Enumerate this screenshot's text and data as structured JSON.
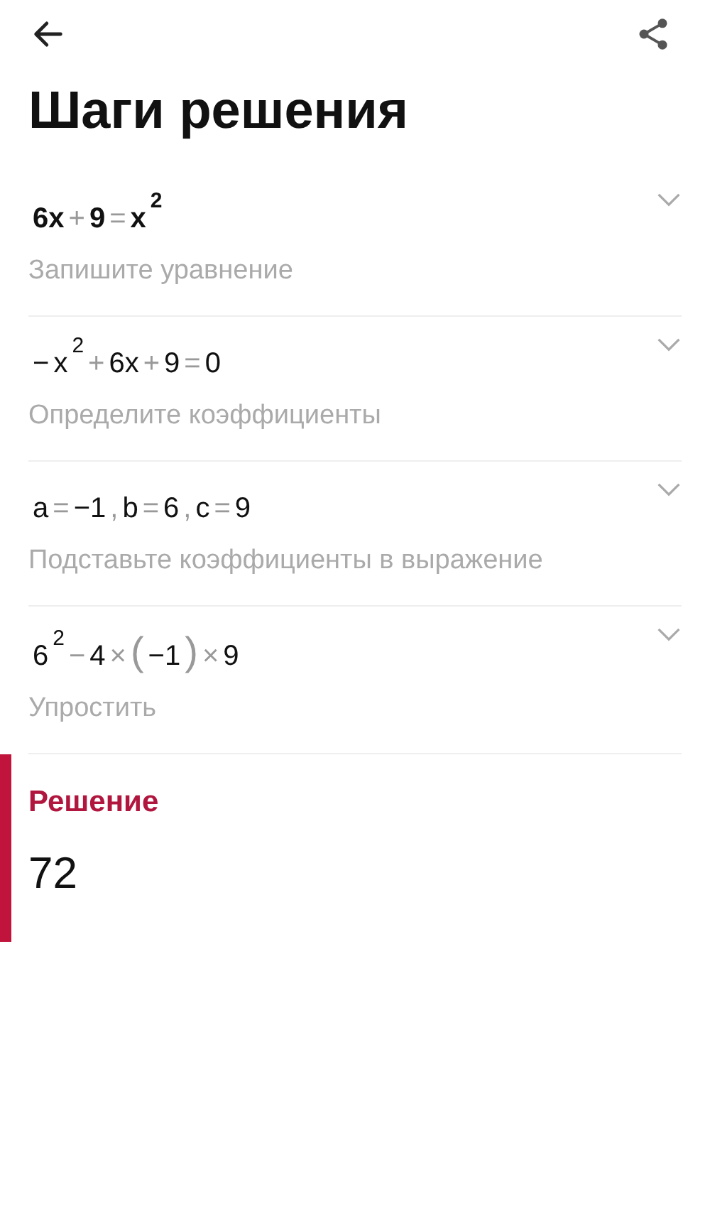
{
  "header": {
    "title": "Шаги решения"
  },
  "steps": [
    {
      "bold": true,
      "expanded": false,
      "description": "Запишите уравнение",
      "expression": [
        {
          "kind": "term",
          "text": "6x"
        },
        {
          "kind": "op",
          "text": "+"
        },
        {
          "kind": "term",
          "text": "9"
        },
        {
          "kind": "op",
          "text": "="
        },
        {
          "kind": "term",
          "text": "x"
        },
        {
          "kind": "sup",
          "text": "2"
        }
      ]
    },
    {
      "bold": false,
      "expanded": false,
      "description": "Определите коэффициенты",
      "expression": [
        {
          "kind": "term",
          "text": "−"
        },
        {
          "kind": "term",
          "text": "x"
        },
        {
          "kind": "sup",
          "text": "2"
        },
        {
          "kind": "op",
          "text": "+"
        },
        {
          "kind": "term",
          "text": "6x"
        },
        {
          "kind": "op",
          "text": "+"
        },
        {
          "kind": "term",
          "text": "9"
        },
        {
          "kind": "op",
          "text": "="
        },
        {
          "kind": "term",
          "text": "0"
        }
      ]
    },
    {
      "bold": false,
      "expanded": false,
      "description": "Подставьте коэффициенты в выражение",
      "expression": [
        {
          "kind": "term",
          "text": "a"
        },
        {
          "kind": "op",
          "text": "="
        },
        {
          "kind": "term",
          "text": "−1"
        },
        {
          "kind": "op",
          "text": ","
        },
        {
          "kind": "term",
          "text": "b"
        },
        {
          "kind": "op",
          "text": "="
        },
        {
          "kind": "term",
          "text": "6"
        },
        {
          "kind": "op",
          "text": ","
        },
        {
          "kind": "term",
          "text": "c"
        },
        {
          "kind": "op",
          "text": "="
        },
        {
          "kind": "term",
          "text": "9"
        }
      ]
    },
    {
      "bold": false,
      "expanded": false,
      "description": "Упростить",
      "expression": [
        {
          "kind": "term",
          "text": "6"
        },
        {
          "kind": "sup",
          "text": "2"
        },
        {
          "kind": "op",
          "text": "−"
        },
        {
          "kind": "term",
          "text": "4"
        },
        {
          "kind": "op",
          "text": "×"
        },
        {
          "kind": "paren",
          "text": "("
        },
        {
          "kind": "term",
          "text": "−1"
        },
        {
          "kind": "paren",
          "text": ")"
        },
        {
          "kind": "op",
          "text": "×"
        },
        {
          "kind": "term",
          "text": "9"
        }
      ]
    }
  ],
  "solution": {
    "label": "Решение",
    "value": "72"
  }
}
